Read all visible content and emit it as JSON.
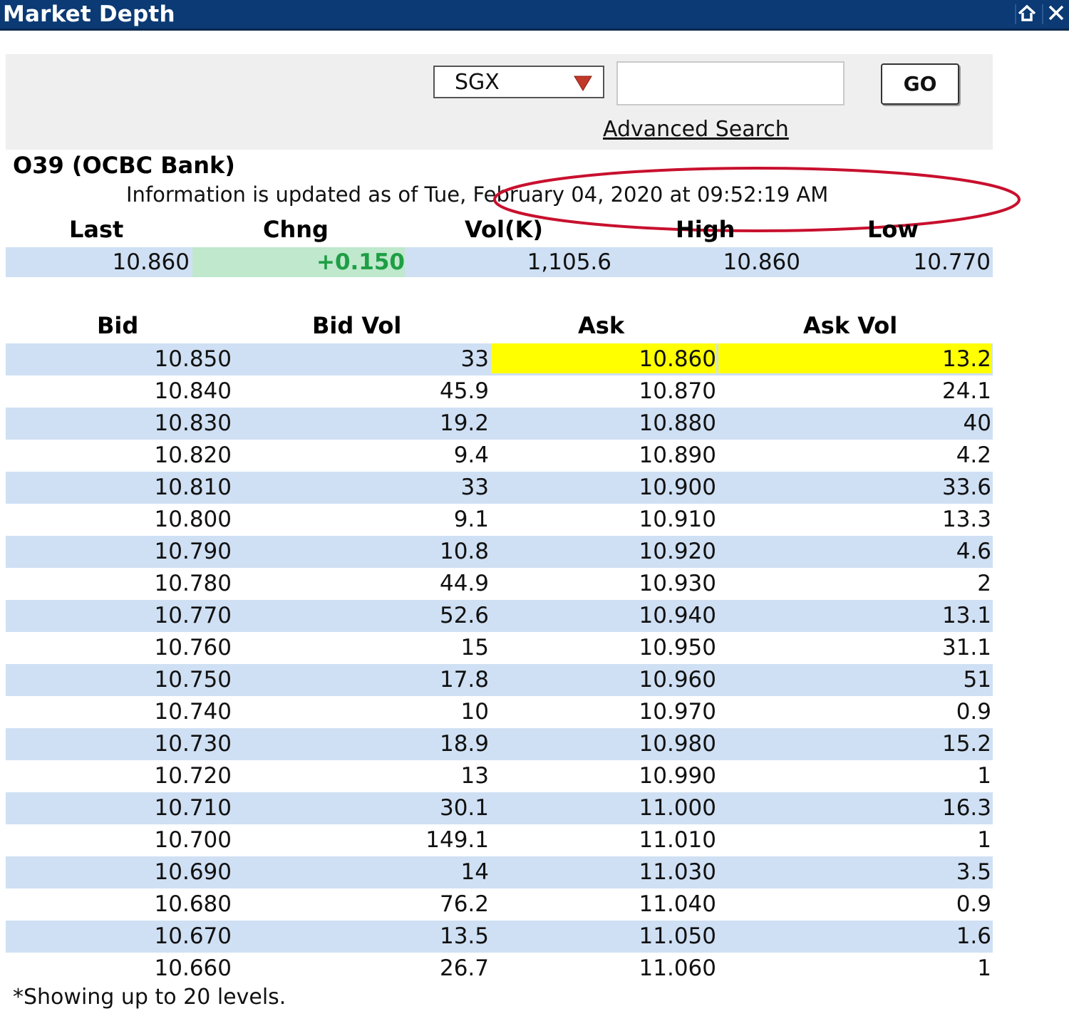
{
  "window": {
    "title": "Market Depth"
  },
  "search": {
    "exchange": "SGX",
    "symbol_value": "",
    "go_label": "GO",
    "advanced_search_label": "Advanced Search"
  },
  "stock": {
    "name": "O39 (OCBC Bank)",
    "update_text": "Information is updated as of Tue, February 04, 2020 at 09:52:19 AM"
  },
  "summary": {
    "headers": {
      "last": "Last",
      "chng": "Chng",
      "vol": "Vol(K)",
      "high": "High",
      "low": "Low"
    },
    "values": {
      "last": "10.860",
      "chng": "+0.150",
      "vol": "1,105.6",
      "high": "10.860",
      "low": "10.770"
    }
  },
  "depth": {
    "headers": {
      "bid": "Bid",
      "bid_vol": "Bid Vol",
      "ask": "Ask",
      "ask_vol": "Ask Vol"
    },
    "rows": [
      {
        "bid": "10.850",
        "bid_vol": "33",
        "ask": "10.860",
        "ask_vol": "13.2"
      },
      {
        "bid": "10.840",
        "bid_vol": "45.9",
        "ask": "10.870",
        "ask_vol": "24.1"
      },
      {
        "bid": "10.830",
        "bid_vol": "19.2",
        "ask": "10.880",
        "ask_vol": "40"
      },
      {
        "bid": "10.820",
        "bid_vol": "9.4",
        "ask": "10.890",
        "ask_vol": "4.2"
      },
      {
        "bid": "10.810",
        "bid_vol": "33",
        "ask": "10.900",
        "ask_vol": "33.6"
      },
      {
        "bid": "10.800",
        "bid_vol": "9.1",
        "ask": "10.910",
        "ask_vol": "13.3"
      },
      {
        "bid": "10.790",
        "bid_vol": "10.8",
        "ask": "10.920",
        "ask_vol": "4.6"
      },
      {
        "bid": "10.780",
        "bid_vol": "44.9",
        "ask": "10.930",
        "ask_vol": "2"
      },
      {
        "bid": "10.770",
        "bid_vol": "52.6",
        "ask": "10.940",
        "ask_vol": "13.1"
      },
      {
        "bid": "10.760",
        "bid_vol": "15",
        "ask": "10.950",
        "ask_vol": "31.1"
      },
      {
        "bid": "10.750",
        "bid_vol": "17.8",
        "ask": "10.960",
        "ask_vol": "51"
      },
      {
        "bid": "10.740",
        "bid_vol": "10",
        "ask": "10.970",
        "ask_vol": "0.9"
      },
      {
        "bid": "10.730",
        "bid_vol": "18.9",
        "ask": "10.980",
        "ask_vol": "15.2"
      },
      {
        "bid": "10.720",
        "bid_vol": "13",
        "ask": "10.990",
        "ask_vol": "1"
      },
      {
        "bid": "10.710",
        "bid_vol": "30.1",
        "ask": "11.000",
        "ask_vol": "16.3"
      },
      {
        "bid": "10.700",
        "bid_vol": "149.1",
        "ask": "11.010",
        "ask_vol": "1"
      },
      {
        "bid": "10.690",
        "bid_vol": "14",
        "ask": "11.030",
        "ask_vol": "3.5"
      },
      {
        "bid": "10.680",
        "bid_vol": "76.2",
        "ask": "11.040",
        "ask_vol": "0.9"
      },
      {
        "bid": "10.670",
        "bid_vol": "13.5",
        "ask": "11.050",
        "ask_vol": "1.6"
      },
      {
        "bid": "10.660",
        "bid_vol": "26.7",
        "ask": "11.060",
        "ask_vol": "1"
      }
    ]
  },
  "footnote": "*Showing up to 20 levels.",
  "colors": {
    "titlebar": "#0b3a74",
    "row_alt": "#cfe0f4",
    "best_ask_highlight": "#ffff00",
    "change_positive": "#1e9e45",
    "annotation_ellipse": "#c8102e"
  },
  "icons": {
    "titlebar_left": "home-icon",
    "titlebar_right": "close-icon"
  }
}
